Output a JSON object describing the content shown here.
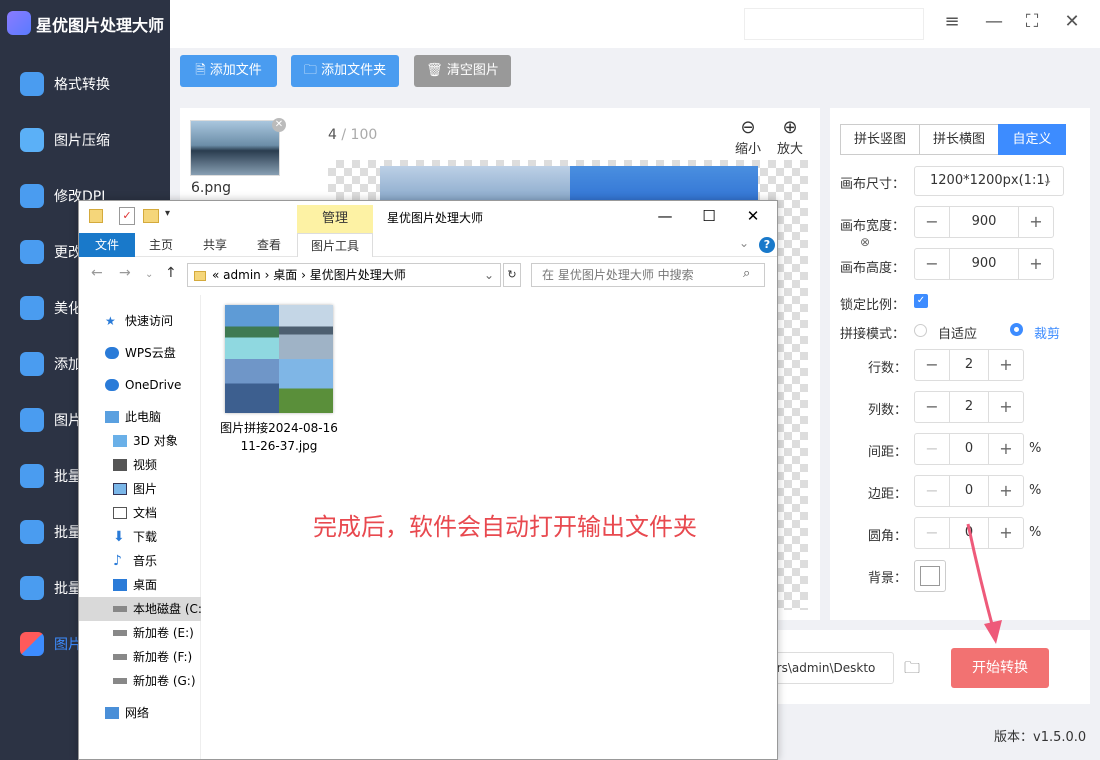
{
  "app": {
    "title": "星优图片处理大师"
  },
  "sidebar": {
    "items": [
      {
        "label": "格式转换",
        "color": "#4a9cf0"
      },
      {
        "label": "图片压缩",
        "color": "#5bb0f7"
      },
      {
        "label": "修改DPI",
        "color": "#4a9cf0"
      },
      {
        "label": "更改",
        "color": "#4a9cf0"
      },
      {
        "label": "美化",
        "color": "#4a9cf0"
      },
      {
        "label": "添加",
        "color": "#4a9cf0"
      },
      {
        "label": "图片",
        "color": "#4a9cf0"
      },
      {
        "label": "批量",
        "color": "#4a9cf0"
      },
      {
        "label": "批量",
        "color": "#4a9cf0"
      },
      {
        "label": "批量",
        "color": "#4a9cf0"
      },
      {
        "label": "图片",
        "color": "#3d8cff"
      }
    ]
  },
  "toolbar": {
    "add_file": "添加文件",
    "add_folder": "添加文件夹",
    "clear": "清空图片"
  },
  "preview": {
    "thumb_name": "6.png",
    "page_current": "4",
    "page_total": "/ 100",
    "zoom_out": "缩小",
    "zoom_in": "放大"
  },
  "settings": {
    "modes": [
      "拼长竖图",
      "拼长横图",
      "自定义"
    ],
    "canvas_size_label": "画布尺寸：",
    "canvas_size_value": "1200*1200px(1:1)",
    "canvas_width_label": "画布宽度：",
    "canvas_width": "900",
    "canvas_height_label": "画布高度：",
    "canvas_height": "900",
    "lock_ratio_label": "锁定比例：",
    "mode_label": "拼接模式：",
    "mode_fit": "自适应",
    "mode_crop": "裁剪",
    "rows_label": "行数：",
    "rows": "2",
    "cols_label": "列数：",
    "cols": "2",
    "spacing_label": "间距：",
    "spacing": "0",
    "margin_label": "边距：",
    "margin": "0",
    "radius_label": "圆角：",
    "radius": "0",
    "percent": "%",
    "background_label": "背景："
  },
  "output": {
    "path": "sers\\admin\\Deskto",
    "start": "开始转换"
  },
  "version": "版本：v1.5.0.0",
  "explorer": {
    "manage_tab": "管理",
    "window_title": "星优图片处理大师",
    "ribbon_tabs": [
      "文件",
      "主页",
      "共享",
      "查看",
      "图片工具"
    ],
    "address": [
      "«",
      "admin",
      "›",
      "桌面",
      "›",
      "星优图片处理大师"
    ],
    "search_placeholder": "在 星优图片处理大师 中搜索",
    "tree": [
      {
        "label": "快速访问",
        "icon": "star-icon"
      },
      {
        "label": "WPS云盘",
        "icon": "cloud-icon"
      },
      {
        "label": "OneDrive",
        "icon": "cloud-icon"
      },
      {
        "label": "此电脑",
        "icon": "computer-icon"
      },
      {
        "label": "3D 对象",
        "icon": "cube-icon"
      },
      {
        "label": "视频",
        "icon": "video-icon"
      },
      {
        "label": "图片",
        "icon": "picture-icon"
      },
      {
        "label": "文档",
        "icon": "document-icon"
      },
      {
        "label": "下载",
        "icon": "download-icon"
      },
      {
        "label": "音乐",
        "icon": "music-icon"
      },
      {
        "label": "桌面",
        "icon": "desktop-icon"
      },
      {
        "label": "本地磁盘 (C:",
        "icon": "drive-icon"
      },
      {
        "label": "新加卷 (E:)",
        "icon": "drive-icon"
      },
      {
        "label": "新加卷 (F:)",
        "icon": "drive-icon"
      },
      {
        "label": "新加卷 (G:)",
        "icon": "drive-icon"
      },
      {
        "label": "网络",
        "icon": "network-icon"
      }
    ],
    "file_name_line1": "图片拼接2024-08-16",
    "file_name_line2": "11-26-37.jpg"
  },
  "annotation": "完成后，软件会自动打开输出文件夹"
}
